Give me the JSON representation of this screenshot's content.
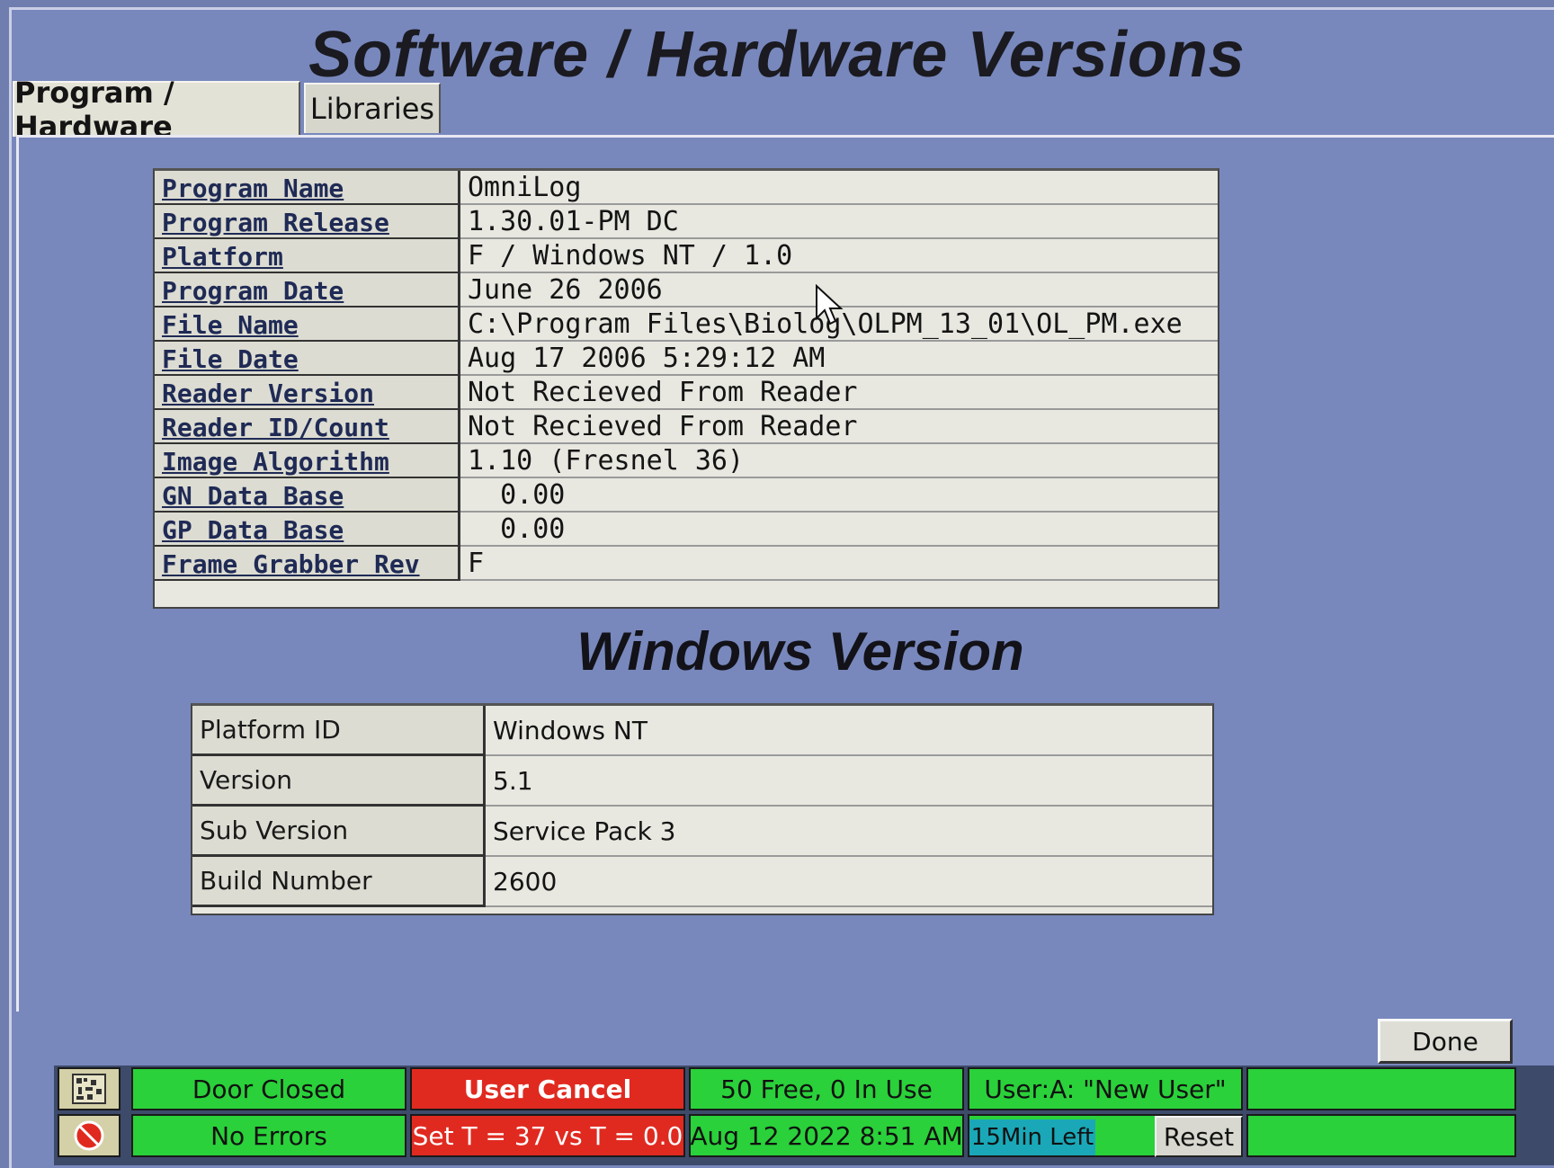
{
  "window": {
    "title": "Software / Hardware Versions"
  },
  "tabs": [
    {
      "label": "Program / Hardware"
    },
    {
      "label": "Libraries"
    }
  ],
  "program_info": [
    {
      "label": "Program Name",
      "value": "OmniLog"
    },
    {
      "label": "Program Release",
      "value": "1.30.01-PM DC"
    },
    {
      "label": "Platform",
      "value": "F / Windows NT / 1.0"
    },
    {
      "label": "Program Date",
      "value": "June 26 2006"
    },
    {
      "label": "File Name",
      "value": "C:\\Program Files\\Biolog\\OLPM_13_01\\OL_PM.exe"
    },
    {
      "label": "File Date",
      "value": "Aug 17 2006 5:29:12 AM"
    },
    {
      "label": "Reader Version",
      "value": "Not Recieved From Reader"
    },
    {
      "label": "Reader ID/Count",
      "value": "Not Recieved From Reader"
    },
    {
      "label": "Image Algorithm",
      "value": "1.10 (Fresnel 36)"
    },
    {
      "label": "GN Data Base",
      "value": "  0.00"
    },
    {
      "label": "GP Data Base",
      "value": "  0.00"
    },
    {
      "label": "Frame Grabber Rev",
      "value": "F"
    }
  ],
  "windows_version": {
    "heading": "Windows Version",
    "rows": [
      {
        "label": "Platform ID",
        "value": "Windows NT"
      },
      {
        "label": "Version",
        "value": "5.1"
      },
      {
        "label": "Sub Version",
        "value": "Service Pack 3"
      },
      {
        "label": "Build Number",
        "value": "2600"
      }
    ]
  },
  "buttons": {
    "done": "Done",
    "reset": "Reset"
  },
  "status_bar": {
    "door": "Door Closed",
    "cancel": "User Cancel",
    "slots": "50 Free, 0 In Use",
    "user": "User:A: \"New User\"",
    "errors": "No Errors",
    "temperature": "Set T = 37 vs T = 0.0",
    "datetime": "Aug 12 2022 8:51 AM",
    "time_left": "15Min Left"
  },
  "colors": {
    "ok": "#2ad13a",
    "alert": "#e02a20",
    "background": "#7888bd",
    "timer": "#1aa8b8"
  },
  "icons": {
    "top_status": "barcode-icon",
    "bottom_status": "stop-sign-icon"
  }
}
